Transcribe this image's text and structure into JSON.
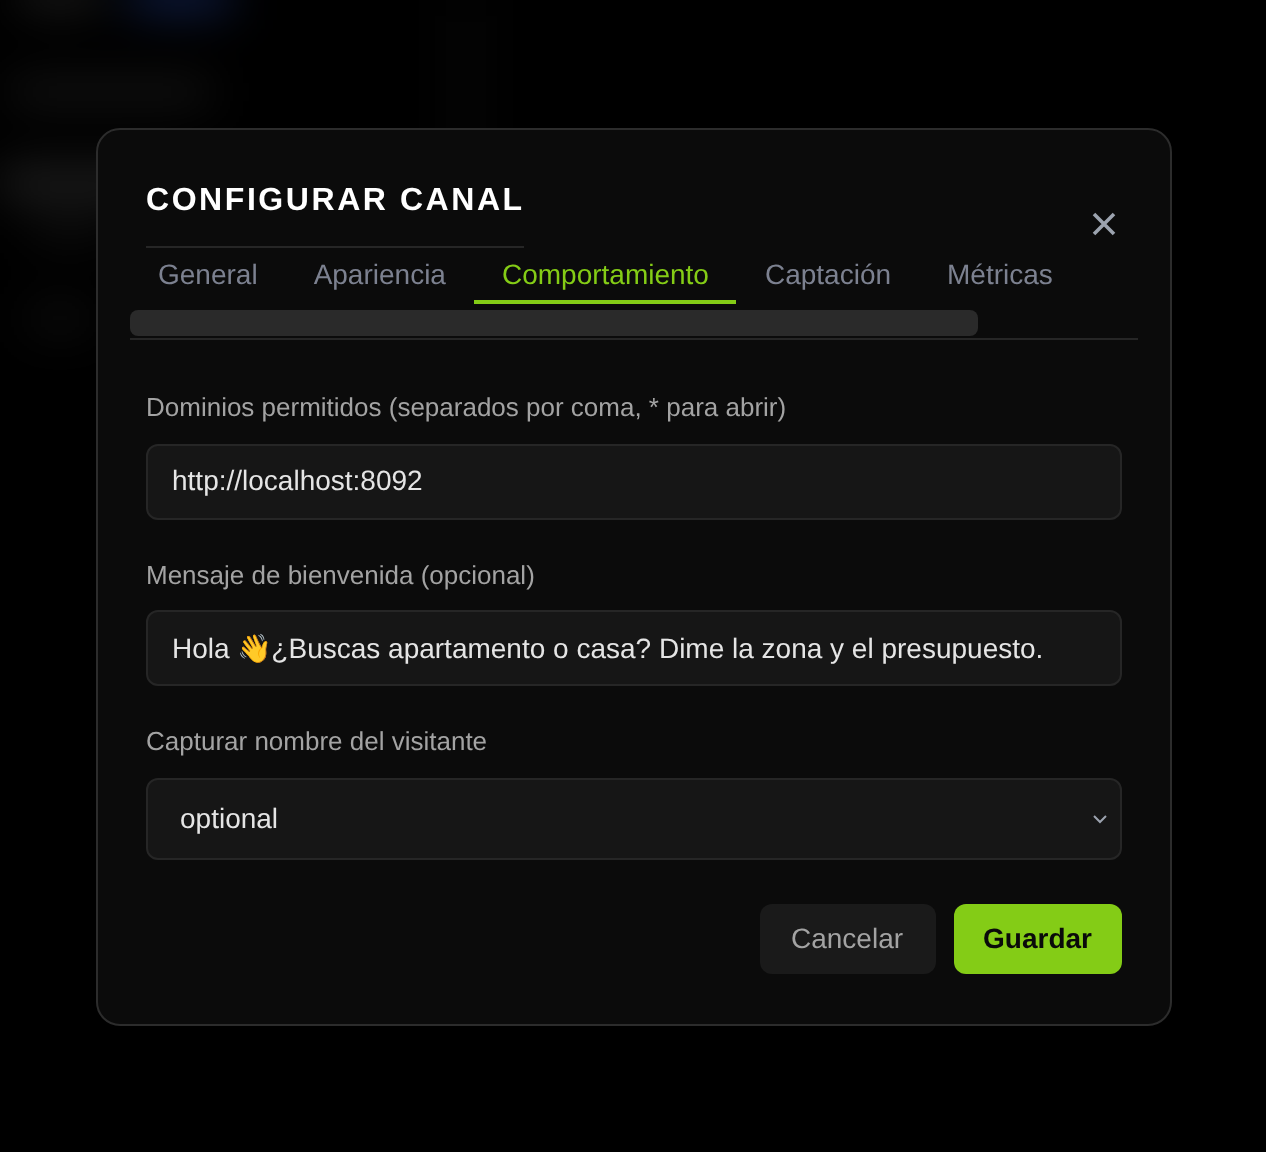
{
  "dialog": {
    "title": "CONFIGURAR CANAL",
    "tabs": [
      {
        "label": "General",
        "selected": false
      },
      {
        "label": "Apariencia",
        "selected": false
      },
      {
        "label": "Comportamiento",
        "selected": true
      },
      {
        "label": "Captación",
        "selected": false
      },
      {
        "label": "Métricas",
        "selected": false
      }
    ],
    "fields": [
      {
        "kind": "text",
        "label": "Dominios permitidos (separados por coma, * para abrir)",
        "value": "http://localhost:8092"
      },
      {
        "kind": "text",
        "label": "Mensaje de bienvenida (opcional)",
        "value": "Hola 👋¿Buscas apartamento o casa? Dime la zona y el presupuesto."
      },
      {
        "kind": "select",
        "label": "Capturar nombre del visitante",
        "value": "optional"
      }
    ],
    "buttons": [
      {
        "kind": "secondary",
        "label": "Cancelar"
      },
      {
        "kind": "primary",
        "label": "Guardar"
      }
    ]
  }
}
